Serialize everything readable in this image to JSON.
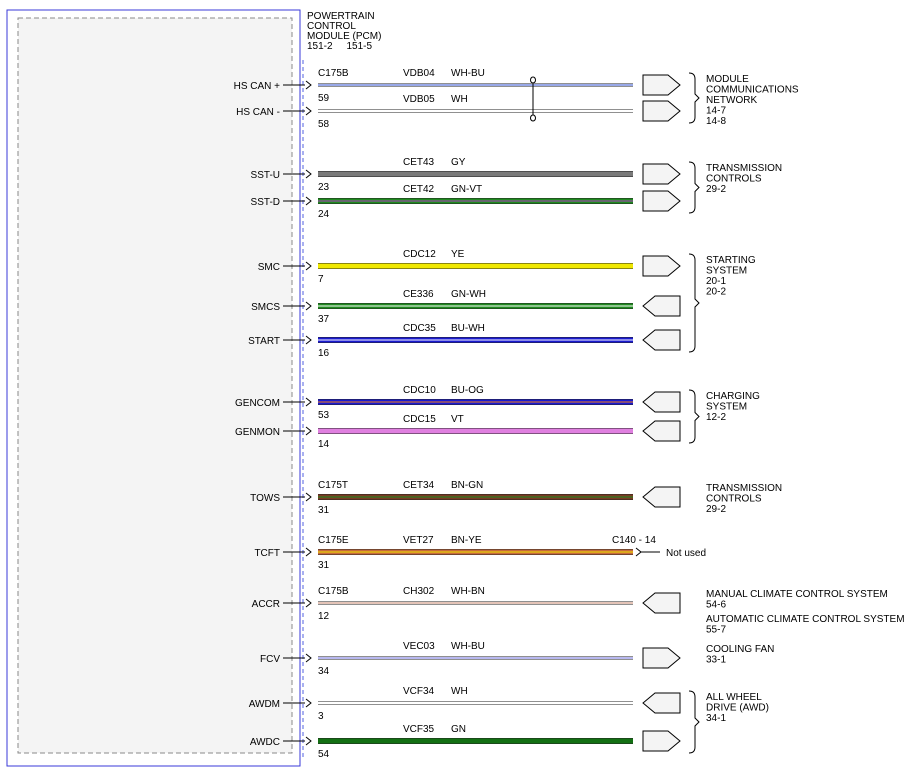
{
  "module": {
    "title_lines": [
      "POWERTRAIN",
      "CONTROL",
      "MODULE (PCM)"
    ],
    "page_refs": "151-2     151-5"
  },
  "circuits": [
    {
      "signal": "HS CAN +",
      "connector": "C175B",
      "pin": "59",
      "circuit": "VDB04",
      "color_code": "WH-BU",
      "wire_color": "#ffffff",
      "stripe_color": "#3050d0",
      "connector_end": "out"
    },
    {
      "signal": "HS CAN -",
      "connector": "",
      "pin": "58",
      "circuit": "VDB05",
      "color_code": "WH",
      "wire_color": "#ffffff",
      "stripe_color": "",
      "connector_end": "out"
    },
    {
      "signal": "SST-U",
      "connector": "",
      "pin": "23",
      "circuit": "CET43",
      "color_code": "GY",
      "wire_color": "#7a7a7a",
      "stripe_color": "",
      "connector_end": "out"
    },
    {
      "signal": "SST-D",
      "connector": "",
      "pin": "24",
      "circuit": "CET42",
      "color_code": "GN-VT",
      "wire_color": "#1f8a1f",
      "stripe_color": "#b040c0",
      "connector_end": "out"
    },
    {
      "signal": "SMC",
      "connector": "",
      "pin": "7",
      "circuit": "CDC12",
      "color_code": "YE",
      "wire_color": "#f0e800",
      "stripe_color": "",
      "connector_end": "out"
    },
    {
      "signal": "SMCS",
      "connector": "",
      "pin": "37",
      "circuit": "CE336",
      "color_code": "GN-WH",
      "wire_color": "#1f8a1f",
      "stripe_color": "#ffffff",
      "connector_end": "in"
    },
    {
      "signal": "START",
      "connector": "",
      "pin": "16",
      "circuit": "CDC35",
      "color_code": "BU-WH",
      "wire_color": "#1a1ad0",
      "stripe_color": "#ffffff",
      "connector_end": "in"
    },
    {
      "signal": "GENCOM",
      "connector": "",
      "pin": "53",
      "circuit": "CDC10",
      "color_code": "BU-OG",
      "wire_color": "#1a1ad0",
      "stripe_color": "#f08020",
      "connector_end": "in"
    },
    {
      "signal": "GENMON",
      "connector": "",
      "pin": "14",
      "circuit": "CDC15",
      "color_code": "VT",
      "wire_color": "#e080e0",
      "stripe_color": "",
      "connector_end": "in"
    },
    {
      "signal": "TOWS",
      "connector": "C175T",
      "pin": "31",
      "circuit": "CET34",
      "color_code": "BN-GN",
      "wire_color": "#7a3a22",
      "stripe_color": "#1f8a1f",
      "connector_end": "in"
    },
    {
      "signal": "TCFT",
      "connector": "C175E",
      "pin": "31",
      "circuit": "VET27",
      "color_code": "BN-YE",
      "wire_color": "#c86a3c",
      "stripe_color": "#f0e800",
      "connector_end": "term"
    },
    {
      "signal": "ACCR",
      "connector": "C175B",
      "pin": "12",
      "circuit": "CH302",
      "color_code": "WH-BN",
      "wire_color": "#ffffff",
      "stripe_color": "#c88a70",
      "connector_end": "in"
    },
    {
      "signal": "FCV",
      "connector": "",
      "pin": "34",
      "circuit": "VEC03",
      "color_code": "WH-BU",
      "wire_color": "#ffffff",
      "stripe_color": "#7070e0",
      "connector_end": "out"
    },
    {
      "signal": "AWDM",
      "connector": "",
      "pin": "3",
      "circuit": "VCF34",
      "color_code": "WH",
      "wire_color": "#ffffff",
      "stripe_color": "",
      "connector_end": "in"
    },
    {
      "signal": "AWDC",
      "connector": "",
      "pin": "54",
      "circuit": "VCF35",
      "color_code": "GN",
      "wire_color": "#137013",
      "stripe_color": "",
      "connector_end": "out"
    }
  ],
  "destinations": [
    {
      "lines": [
        "MODULE",
        "COMMUNICATIONS",
        "NETWORK",
        "14-7",
        "14-8"
      ],
      "rows": [
        0,
        1
      ]
    },
    {
      "lines": [
        "TRANSMISSION",
        "CONTROLS",
        "29-2"
      ],
      "rows": [
        2,
        3
      ]
    },
    {
      "lines": [
        "STARTING",
        "SYSTEM",
        "20-1",
        "20-2"
      ],
      "rows": [
        4,
        5,
        6
      ]
    },
    {
      "lines": [
        "CHARGING",
        "SYSTEM",
        "12-2"
      ],
      "rows": [
        7,
        8
      ]
    },
    {
      "lines": [
        "TRANSMISSION",
        "CONTROLS",
        "29-2"
      ],
      "rows": [
        9
      ]
    },
    {
      "lines": [
        "MANUAL CLIMATE CONTROL SYSTEM",
        "54-6",
        "AUTOMATIC CLIMATE CONTROL SYSTEM",
        "55-7"
      ],
      "rows": [
        11
      ]
    },
    {
      "lines": [
        "COOLING FAN",
        "33-1"
      ],
      "rows": [
        12
      ]
    },
    {
      "lines": [
        "ALL WHEEL",
        "DRIVE (AWD)",
        "34-1"
      ],
      "rows": [
        13,
        14
      ]
    }
  ],
  "terminal": {
    "connector_pin": "C140 - 14",
    "note": "Not used"
  },
  "colors": {
    "module_border": "#3a3ad8",
    "module_fill": "#f4f4f4",
    "dashed": "#8a8a8a"
  }
}
